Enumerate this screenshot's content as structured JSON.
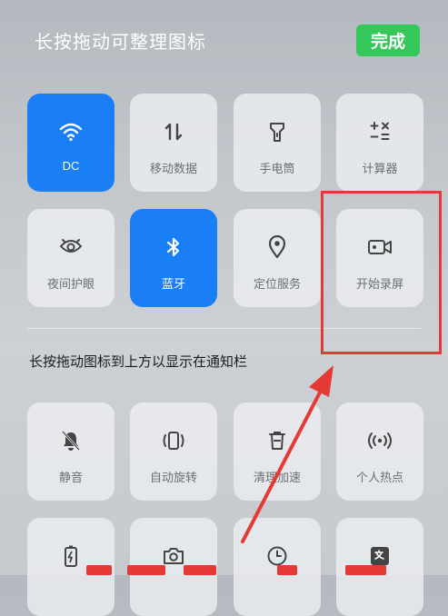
{
  "header": {
    "title": "长按拖动可整理图标",
    "done_label": "完成"
  },
  "active_tiles": {
    "items": [
      {
        "label": "DC",
        "icon": "wifi-icon",
        "active": true
      },
      {
        "label": "移动数据",
        "icon": "mobile-data-icon",
        "active": false
      },
      {
        "label": "手电筒",
        "icon": "flashlight-icon",
        "active": false
      },
      {
        "label": "计算器",
        "icon": "calculator-icon",
        "active": false
      },
      {
        "label": "夜间护眼",
        "icon": "eye-icon",
        "active": false
      },
      {
        "label": "蓝牙",
        "icon": "bluetooth-icon",
        "active": true
      },
      {
        "label": "定位服务",
        "icon": "location-icon",
        "active": false
      },
      {
        "label": "开始录屏",
        "icon": "screen-record-icon",
        "active": false
      }
    ]
  },
  "hint_text": "长按拖动图标到上方以显示在通知栏",
  "available_tiles": {
    "items": [
      {
        "label": "静音",
        "icon": "bell-mute-icon"
      },
      {
        "label": "自动旋转",
        "icon": "auto-rotate-icon"
      },
      {
        "label": "清理加速",
        "icon": "trash-icon"
      },
      {
        "label": "个人热点",
        "icon": "hotspot-icon"
      },
      {
        "label": "",
        "icon": "battery-saver-icon"
      },
      {
        "label": "",
        "icon": "camera-icon"
      },
      {
        "label": "",
        "icon": "clock-icon"
      },
      {
        "label": "",
        "icon": "translate-icon"
      }
    ]
  },
  "colors": {
    "active": "#1a7ef6",
    "done_button": "#34c759",
    "annotation": "#e53935"
  }
}
